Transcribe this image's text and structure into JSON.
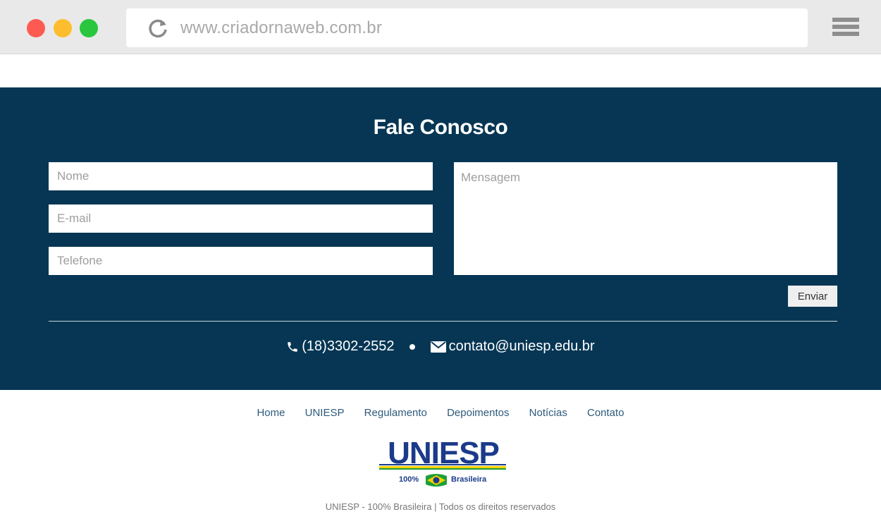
{
  "browser": {
    "url": "www.criadornaweb.com.br"
  },
  "contact": {
    "title": "Fale Conosco",
    "name_placeholder": "Nome",
    "email_placeholder": "E-mail",
    "phone_placeholder": "Telefone",
    "message_placeholder": "Mensagem",
    "send_label": "Enviar",
    "phone": "(18)3302-2552",
    "email": "contato@uniesp.edu.br",
    "background_color": "#063654"
  },
  "footer": {
    "nav": [
      "Home",
      "UNIESP",
      "Regulamento",
      "Depoimentos",
      "Notícias",
      "Contato"
    ],
    "logo": {
      "name": "UNIESP",
      "tagline_left": "100%",
      "tagline_right": "Brasileira"
    },
    "copyright": "UNIESP - 100% Brasileira | Todos os direitos reservados"
  }
}
